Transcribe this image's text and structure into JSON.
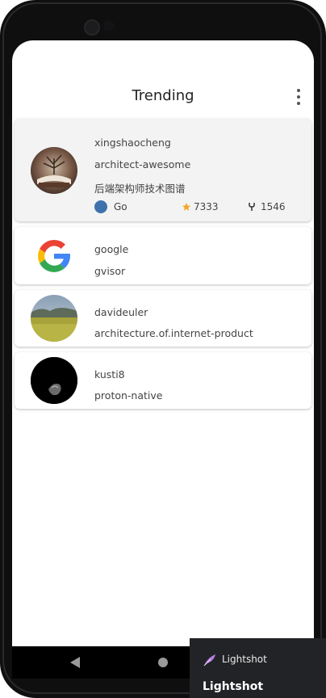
{
  "app": {
    "title": "Trending"
  },
  "repos": [
    {
      "owner": "xingshaocheng",
      "name": "architect-awesome",
      "description": "后端架构师技术图谱",
      "language": "Go",
      "language_color": "#3f72ad",
      "stars": "7333",
      "forks": "1546"
    },
    {
      "owner": "google",
      "name": "gvisor"
    },
    {
      "owner": "davideuler",
      "name": "architecture.of.internet-product"
    },
    {
      "owner": "kusti8",
      "name": "proton-native"
    }
  ],
  "overlay": {
    "app_label": "Lightshot",
    "caption": "Lightshot"
  },
  "icons": {
    "menu": "more-vert-icon",
    "star": "star-icon",
    "fork": "fork-icon",
    "back": "back-icon",
    "home": "home-icon",
    "feather": "lightshot-feather-icon"
  },
  "colors": {
    "star": "#f5a623",
    "language_go": "#3f72ad"
  }
}
